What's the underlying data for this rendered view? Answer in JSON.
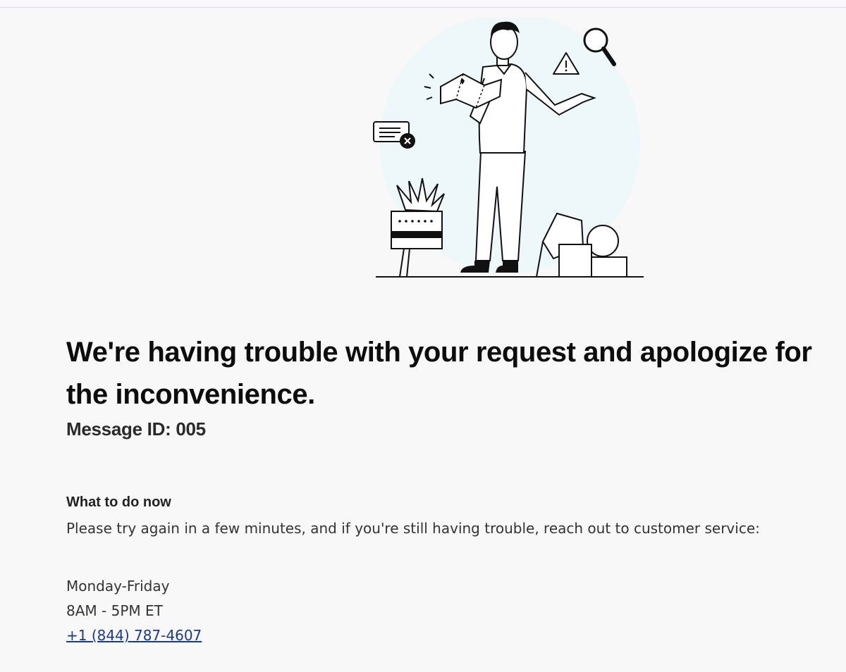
{
  "error": {
    "title": "We're having trouble with your request and apologize for the inconvenience.",
    "message_id": "Message ID: 005"
  },
  "help": {
    "heading": "What to do now",
    "instructions": "Please try again in a few minutes, and if you're still having trouble, reach out to customer service:",
    "days": "Monday-Friday",
    "hours": "8AM - 5PM ET",
    "phone": "+1 (844) 787-4607"
  },
  "icons": {
    "illustration": "confused-person-illustration",
    "alert": "warning-icon",
    "search": "magnifier-icon",
    "error_message": "message-error-icon"
  },
  "colors": {
    "background": "#f8f8f8",
    "illustration_bg": "#eef7fa",
    "link": "#1a3a8c"
  }
}
